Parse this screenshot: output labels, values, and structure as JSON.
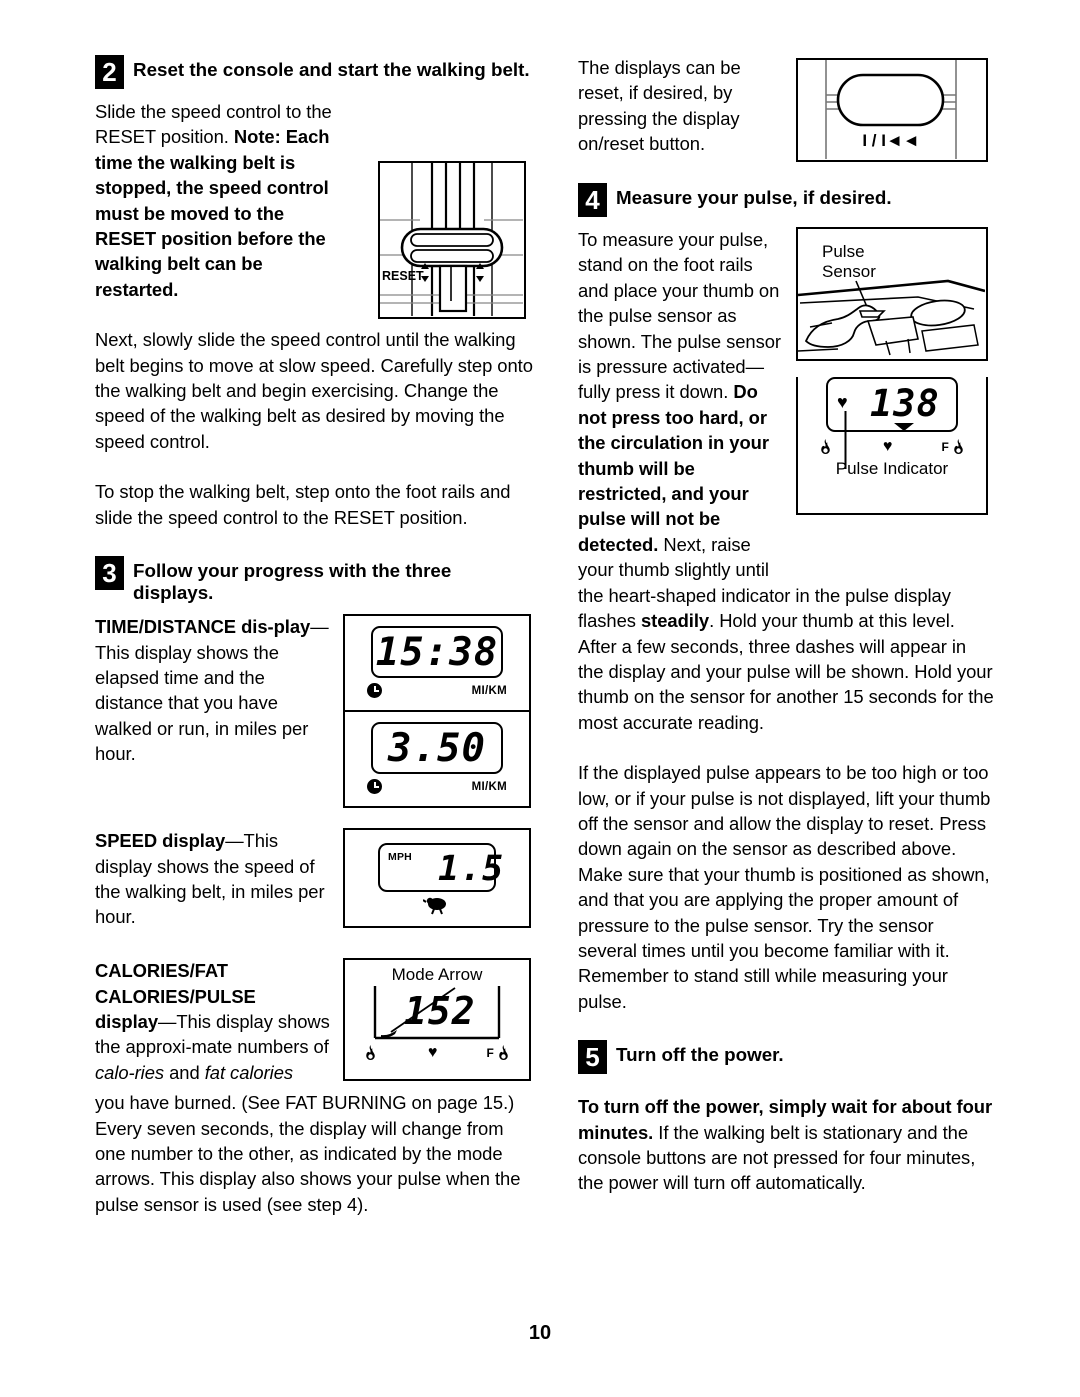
{
  "page": {
    "number": "10"
  },
  "left_column": {
    "step2": {
      "number": "2",
      "title": "Reset the console and start the walking belt.",
      "para1_plain_a": "Slide the speed control to the RESET position. ",
      "para1_bold": "Note: Each time the walking belt is stopped, the speed control must be moved to the RESET position before the walking belt can be restarted.",
      "para2": "Next, slowly slide the speed control until the walking belt begins to move at slow speed. Carefully step onto the walking belt and begin exercising. Change the speed of the walking belt as desired by moving the speed control.",
      "para3": "To stop the walking belt, step onto the foot rails and slide the speed control to the RESET position.",
      "figure": {
        "name": "speed-control-diagram",
        "reset_label": "RESET"
      }
    },
    "step3": {
      "number": "3",
      "title": "Follow your progress with the three displays.",
      "timedist": {
        "bold_lead": "TIME/DISTANCE dis-play",
        "bold_a": "TIME/DISTANCE dis-",
        "bold_b": "play",
        "rest": "—This display shows the elapsed time and the distance that you have walked or run, in miles per hour.",
        "display_time": "15:38",
        "display_distance": "3.50",
        "unit_label": "MI/KM"
      },
      "speed": {
        "bold": "SPEED display",
        "rest": "—This display shows the speed of the walking belt, in miles per hour.",
        "unit_label": "MPH",
        "value": "1.5"
      },
      "calories": {
        "bold_l1": "CALORIES/FAT",
        "bold_l2": "CALORIES/PULSE",
        "bold_l3": "display",
        "rest_a": "—This display shows the approxi-mate numbers of ",
        "italic_a": "calo-ries",
        "plain_b": " and ",
        "italic_b": "fat calories",
        "rest_b": " you have burned. (See FAT BURNING on page 15.) Every seven seconds, the display will change from one number to the other, as indicated by the mode arrows. This display also shows your pulse when the pulse sensor is used (see step 4).",
        "annotation": "Mode Arrow",
        "value": "152",
        "footer_f": "F"
      }
    }
  },
  "right_column": {
    "intro": {
      "para": "The displays can be reset, if desired, by pressing the display on/reset button.",
      "button_label": "I / I◄◄"
    },
    "step4": {
      "number": "4",
      "title": "Measure your pulse, if desired.",
      "para1_plain_a": "To measure your pulse, stand on the foot rails and place your thumb on the pulse sensor as shown. The pulse sensor is pressure activated—fully press it down. ",
      "para1_bold": "Do not press too hard, or the circulation in your thumb will be restricted, and your pulse will not be detected.",
      "para1_plain_b": " Next, raise your thumb slightly until",
      "para2_a": "the heart-shaped indicator in the pulse display flashes ",
      "para2_bold": "steadily",
      "para2_b": ". Hold your thumb at this level. After a few seconds, three dashes will appear in the display and your pulse will be shown. Hold your thumb on the sensor for another 15 seconds for the most accurate reading.",
      "para3": "If the displayed pulse appears to be too high or too low, or if your pulse is not displayed, lift your thumb off the sensor and allow the display to reset. Press down again on the sensor as described above. Make sure that your thumb is positioned as shown, and that you are applying the proper amount of pressure to the pulse sensor. Try the sensor several times until you become familiar with it. Remember to stand still while measuring your pulse.",
      "figure": {
        "label_top_l1": "Pulse",
        "label_top_l2": "Sensor",
        "lcd_value": "138",
        "label_bottom": "Pulse Indicator",
        "footer_f": "F"
      }
    },
    "step5": {
      "number": "5",
      "title": "Turn off the power.",
      "para_bold": "To turn off the power, simply wait for about four minutes.",
      "para_rest": " If the walking belt is stationary and the console buttons are not pressed for four minutes, the power will turn off automatically."
    }
  }
}
